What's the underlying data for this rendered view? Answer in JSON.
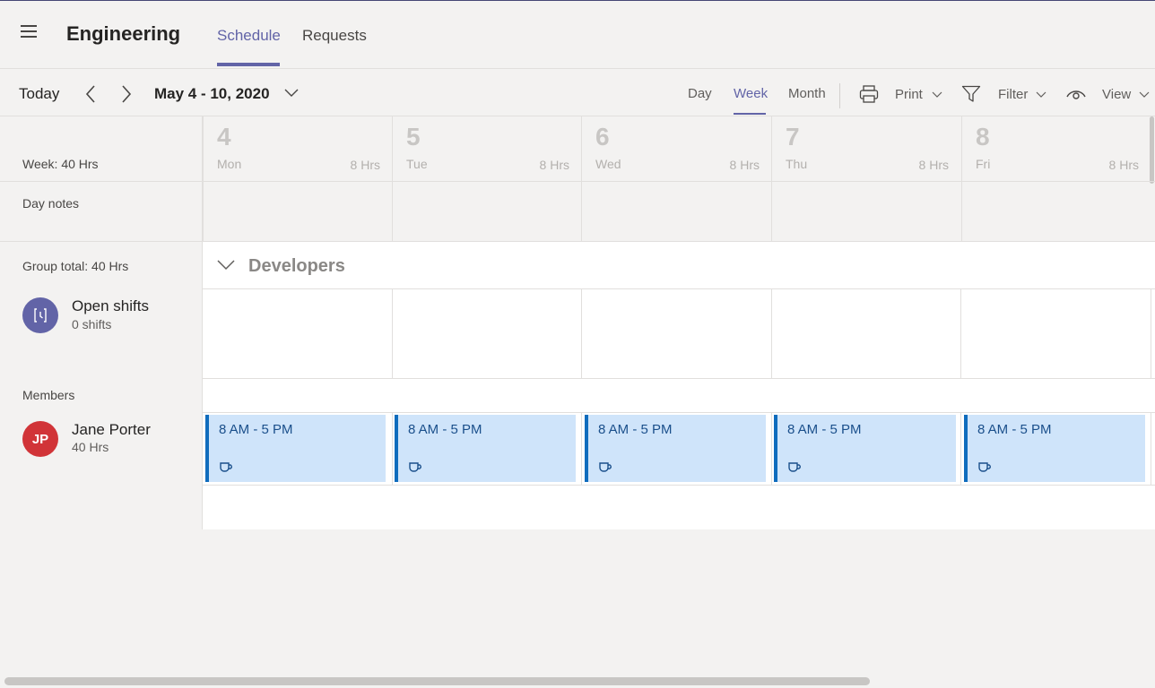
{
  "header": {
    "team_title": "Engineering",
    "tabs": [
      {
        "label": "Schedule",
        "active": true
      },
      {
        "label": "Requests",
        "active": false
      }
    ]
  },
  "toolbar": {
    "today_label": "Today",
    "date_range": "May 4 - 10, 2020",
    "views": [
      {
        "label": "Day",
        "active": false
      },
      {
        "label": "Week",
        "active": true
      },
      {
        "label": "Month",
        "active": false
      }
    ],
    "print_label": "Print",
    "filter_label": "Filter",
    "view_label": "View",
    "icons": [
      "hamburger-icon",
      "chevron-left-icon",
      "chevron-right-icon",
      "chevron-down-icon",
      "printer-icon",
      "filter-icon",
      "eye-icon"
    ]
  },
  "left": {
    "week_total": "Week: 40 Hrs",
    "day_notes": "Day notes",
    "group_total": "Group total: 40 Hrs",
    "open_shifts_title": "Open shifts",
    "open_shifts_count": "0 shifts",
    "members_label": "Members",
    "member": {
      "initials": "JP",
      "name": "Jane Porter",
      "hours": "40 Hrs"
    }
  },
  "days": [
    {
      "num": "4",
      "name": "Mon",
      "hrs": "8 Hrs"
    },
    {
      "num": "5",
      "name": "Tue",
      "hrs": "8 Hrs"
    },
    {
      "num": "6",
      "name": "Wed",
      "hrs": "8 Hrs"
    },
    {
      "num": "7",
      "name": "Thu",
      "hrs": "8 Hrs"
    },
    {
      "num": "8",
      "name": "Fri",
      "hrs": "8 Hrs"
    }
  ],
  "group": {
    "name": "Developers"
  },
  "shifts": [
    {
      "time": "8 AM - 5 PM",
      "icon": "coffee-cup-icon"
    },
    {
      "time": "8 AM - 5 PM",
      "icon": "coffee-cup-icon"
    },
    {
      "time": "8 AM - 5 PM",
      "icon": "coffee-cup-icon"
    },
    {
      "time": "8 AM - 5 PM",
      "icon": "coffee-cup-icon"
    },
    {
      "time": "8 AM - 5 PM",
      "icon": "coffee-cup-icon"
    }
  ],
  "colors": {
    "accent": "#6264a7",
    "shift_bg": "#cfe4fa",
    "shift_border": "#0f6cbd",
    "avatar_member": "#d13438"
  }
}
